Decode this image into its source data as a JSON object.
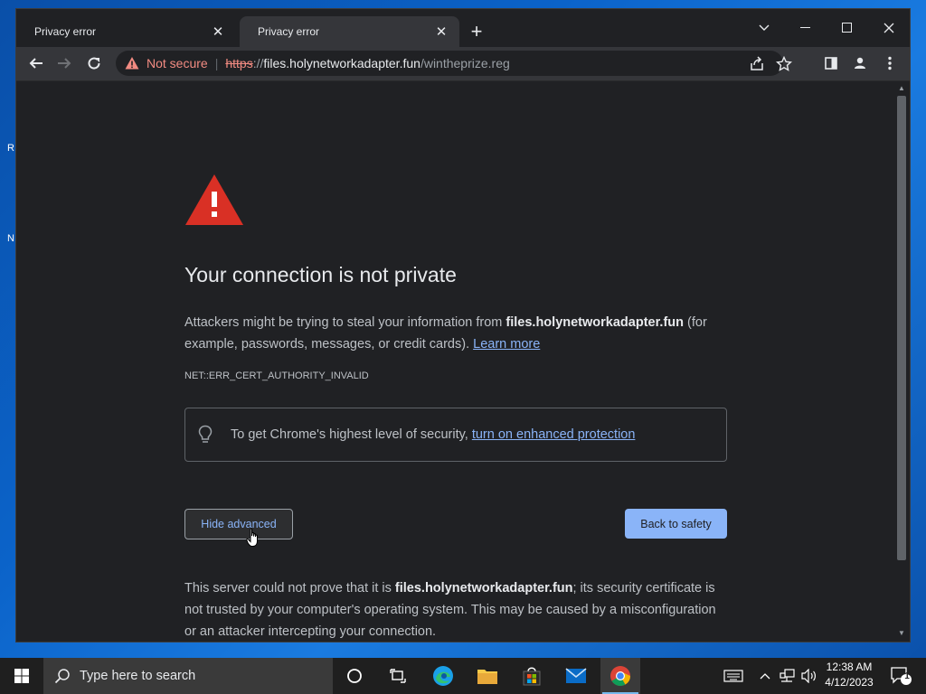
{
  "desktop": {
    "frag_1": "R",
    "frag_2": "N"
  },
  "tabs": [
    {
      "title": "Privacy error",
      "close": "✕"
    },
    {
      "title": "Privacy error",
      "close": "✕"
    }
  ],
  "new_tab": "+",
  "window_controls": {
    "tab_search": "⌄",
    "minimize": "—",
    "maximize": "☐",
    "close": "✕"
  },
  "omnibox": {
    "not_secure": "Not secure",
    "separator": "|",
    "scheme": "https",
    "scheme_sep": "://",
    "host": "files.holynetworkadapter.fun",
    "path": "/wintheprize.reg"
  },
  "page": {
    "heading": "Your connection is not private",
    "para_1": "Attackers might be trying to steal your information from ",
    "para_host": "files.holynetworkadapter.fun",
    "para_2": " (for example, passwords, messages, or credit cards). ",
    "learn_more": "Learn more",
    "error_code": "NET::ERR_CERT_AUTHORITY_INVALID",
    "enhanced_text": "To get Chrome's highest level of security, ",
    "enhanced_link": "turn on enhanced protection",
    "hide_advanced": "Hide advanced",
    "back_to_safety": "Back to safety",
    "details_1": "This server could not prove that it is ",
    "details_host": "files.holynetworkadapter.fun",
    "details_2": "; its security certificate is not trusted by your computer's operating system. This may be caused by a misconfiguration or an attacker intercepting your connection."
  },
  "taskbar": {
    "search_placeholder": "Type here to search",
    "time": "12:38 AM",
    "date": "4/12/2023",
    "notification_count": "1"
  },
  "colors": {
    "accent": "#8ab4f8",
    "danger": "#d93025",
    "not_secure": "#f28b82"
  }
}
